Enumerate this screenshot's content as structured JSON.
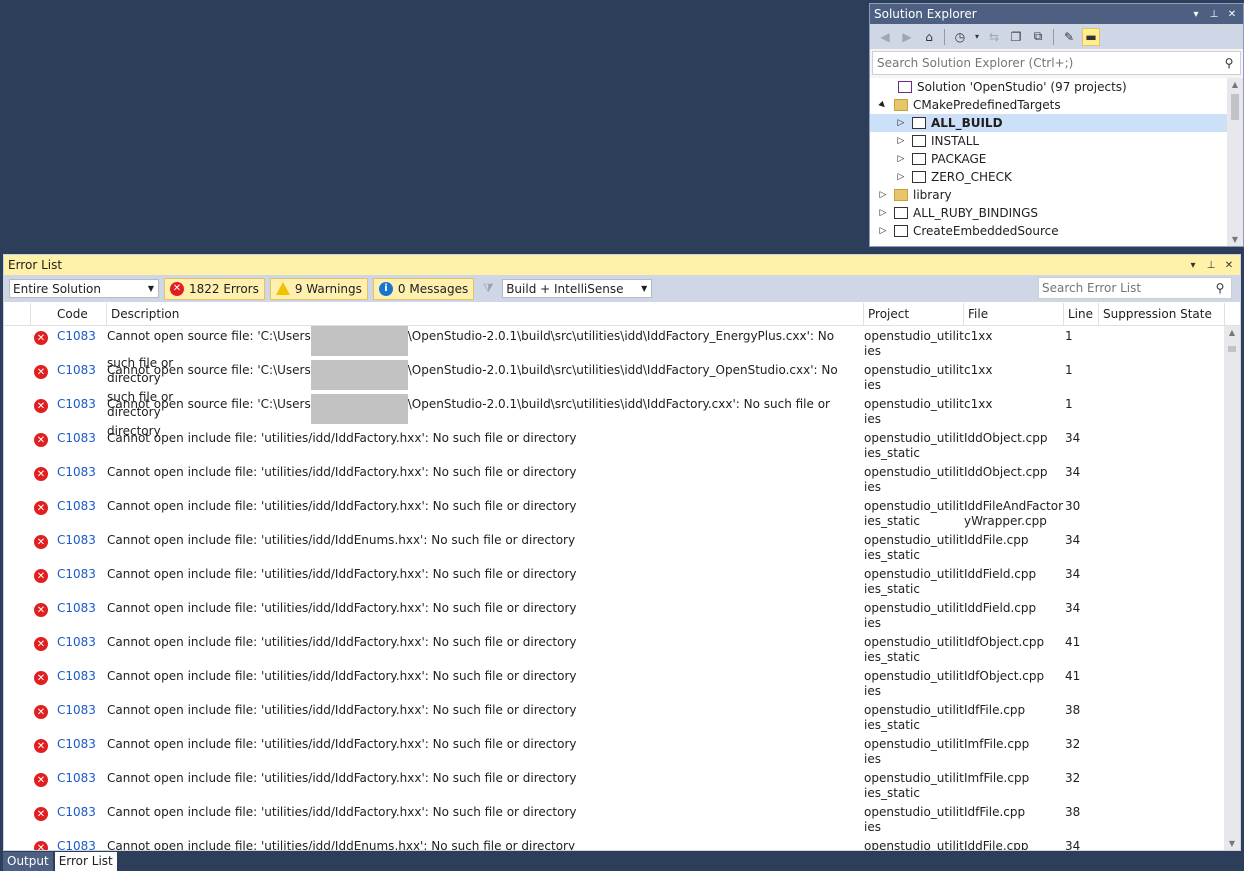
{
  "solution_explorer": {
    "title": "Solution Explorer",
    "search_placeholder": "Search Solution Explorer (Ctrl+;)",
    "tree": [
      {
        "label": "Solution 'OpenStudio' (97 projects)",
        "indent": 0,
        "expander": "",
        "icon": "solution"
      },
      {
        "label": "CMakePredefinedTargets",
        "indent": 0,
        "expander": "▲",
        "icon": "folder"
      },
      {
        "label": "ALL_BUILD",
        "indent": 1,
        "expander": "▷",
        "icon": "project",
        "selected": true
      },
      {
        "label": "INSTALL",
        "indent": 1,
        "expander": "▷",
        "icon": "project"
      },
      {
        "label": "PACKAGE",
        "indent": 1,
        "expander": "▷",
        "icon": "project"
      },
      {
        "label": "ZERO_CHECK",
        "indent": 1,
        "expander": "▷",
        "icon": "project"
      },
      {
        "label": "library",
        "indent": 0,
        "expander": "▷",
        "icon": "folder"
      },
      {
        "label": "ALL_RUBY_BINDINGS",
        "indent": 0,
        "expander": "▷",
        "icon": "project"
      },
      {
        "label": "CreateEmbeddedSource",
        "indent": 0,
        "expander": "▷",
        "icon": "project"
      }
    ]
  },
  "error_list": {
    "title": "Error List",
    "scope": "Entire Solution",
    "errors_label": "1822 Errors",
    "warnings_label": "9 Warnings",
    "messages_label": "0 Messages",
    "build_filter": "Build + IntelliSense",
    "search_placeholder": "Search Error List",
    "columns": {
      "code": "Code",
      "description": "Description",
      "project": "Project",
      "file": "File",
      "line": "Line",
      "suppression": "Suppression State"
    },
    "rows": [
      {
        "code": "C1083",
        "desc_pre": "Cannot open source file: 'C:\\Users",
        "desc_post": "\\OpenStudio-2.0.1\\build\\src\\utilities\\idd\\IddFactory_EnergyPlus.cxx': No such file or",
        "desc_wrap": "directory",
        "project": "openstudio_utilities",
        "file": "c1xx",
        "line": "1"
      },
      {
        "code": "C1083",
        "desc_pre": "Cannot open source file: 'C:\\Users",
        "desc_post": "\\OpenStudio-2.0.1\\build\\src\\utilities\\idd\\IddFactory_OpenStudio.cxx': No such file or",
        "desc_wrap": "directory",
        "project": "openstudio_utilities",
        "file": "c1xx",
        "line": "1"
      },
      {
        "code": "C1083",
        "desc_pre": "Cannot open source file: 'C:\\Users",
        "desc_post": "\\OpenStudio-2.0.1\\build\\src\\utilities\\idd\\IddFactory.cxx': No such file or directory",
        "desc_wrap": "",
        "project": "openstudio_utilities",
        "file": "c1xx",
        "line": "1"
      },
      {
        "code": "C1083",
        "desc": "Cannot open include file: 'utilities/idd/IddFactory.hxx': No such file or directory",
        "project": "openstudio_utilities_static",
        "file": "IddObject.cpp",
        "line": "34"
      },
      {
        "code": "C1083",
        "desc": "Cannot open include file: 'utilities/idd/IddFactory.hxx': No such file or directory",
        "project": "openstudio_utilities",
        "file": "IddObject.cpp",
        "line": "34"
      },
      {
        "code": "C1083",
        "desc": "Cannot open include file: 'utilities/idd/IddFactory.hxx': No such file or directory",
        "project": "openstudio_utilities_static",
        "file": "IddFileAndFactoryWrapper.cpp",
        "line": "30"
      },
      {
        "code": "C1083",
        "desc": "Cannot open include file: 'utilities/idd/IddEnums.hxx': No such file or directory",
        "project": "openstudio_utilities_static",
        "file": "IddFile.cpp",
        "line": "34"
      },
      {
        "code": "C1083",
        "desc": "Cannot open include file: 'utilities/idd/IddFactory.hxx': No such file or directory",
        "project": "openstudio_utilities_static",
        "file": "IddField.cpp",
        "line": "34"
      },
      {
        "code": "C1083",
        "desc": "Cannot open include file: 'utilities/idd/IddFactory.hxx': No such file or directory",
        "project": "openstudio_utilities",
        "file": "IddField.cpp",
        "line": "34"
      },
      {
        "code": "C1083",
        "desc": "Cannot open include file: 'utilities/idd/IddFactory.hxx': No such file or directory",
        "project": "openstudio_utilities_static",
        "file": "IdfObject.cpp",
        "line": "41"
      },
      {
        "code": "C1083",
        "desc": "Cannot open include file: 'utilities/idd/IddFactory.hxx': No such file or directory",
        "project": "openstudio_utilities",
        "file": "IdfObject.cpp",
        "line": "41"
      },
      {
        "code": "C1083",
        "desc": "Cannot open include file: 'utilities/idd/IddFactory.hxx': No such file or directory",
        "project": "openstudio_utilities_static",
        "file": "IdfFile.cpp",
        "line": "38"
      },
      {
        "code": "C1083",
        "desc": "Cannot open include file: 'utilities/idd/IddFactory.hxx': No such file or directory",
        "project": "openstudio_utilities",
        "file": "ImfFile.cpp",
        "line": "32"
      },
      {
        "code": "C1083",
        "desc": "Cannot open include file: 'utilities/idd/IddFactory.hxx': No such file or directory",
        "project": "openstudio_utilities_static",
        "file": "ImfFile.cpp",
        "line": "32"
      },
      {
        "code": "C1083",
        "desc": "Cannot open include file: 'utilities/idd/IddFactory.hxx': No such file or directory",
        "project": "openstudio_utilities",
        "file": "IdfFile.cpp",
        "line": "38"
      },
      {
        "code": "C1083",
        "desc": "Cannot open include file: 'utilities/idd/IddEnums.hxx': No such file or directory",
        "project": "openstudio_utilities",
        "file": "IddFile.cpp",
        "line": "34"
      }
    ]
  },
  "tabs": {
    "output": "Output",
    "error_list": "Error List"
  }
}
